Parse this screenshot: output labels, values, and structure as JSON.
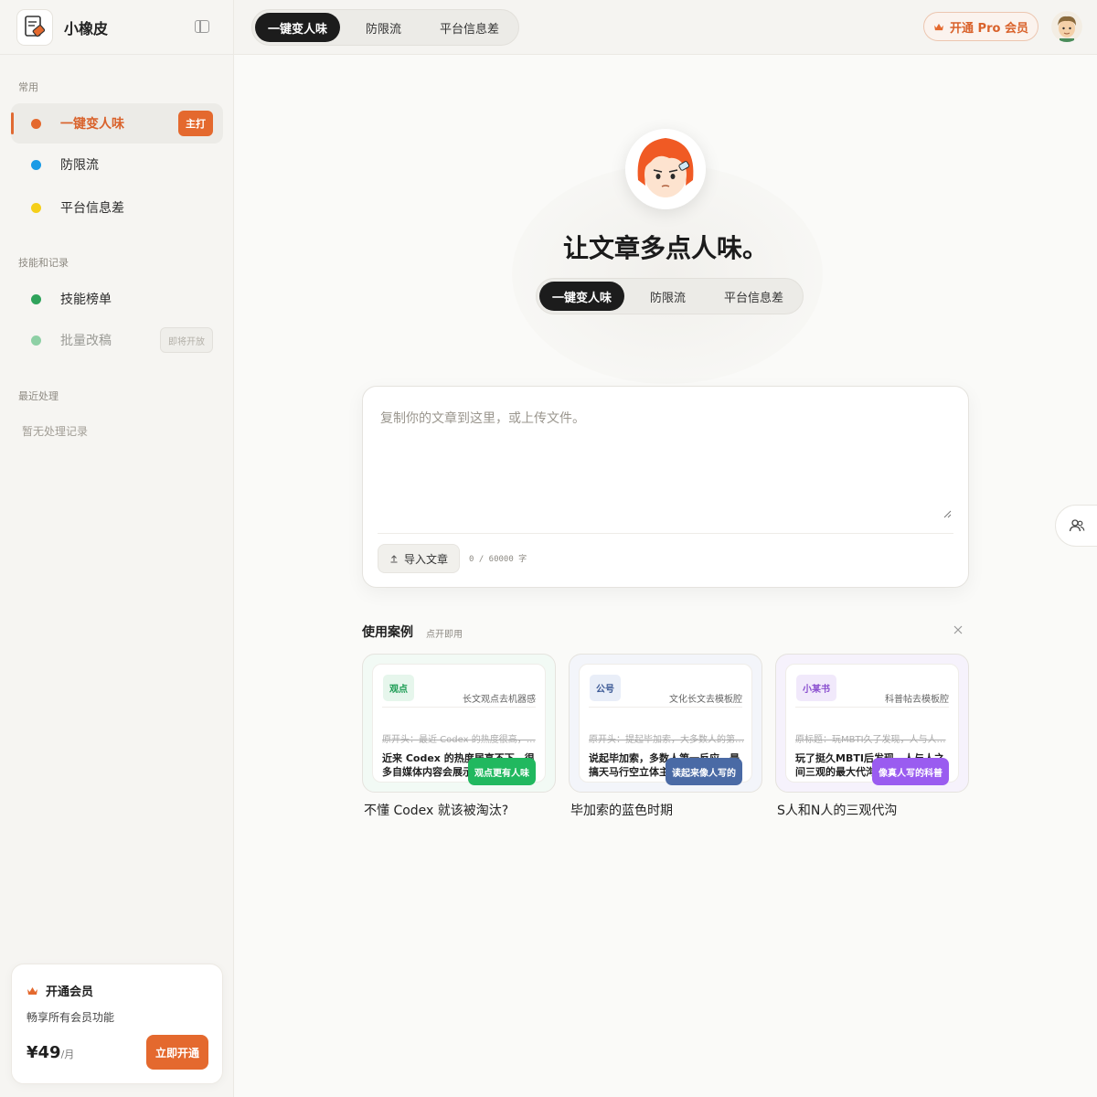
{
  "app": {
    "name": "小橡皮"
  },
  "sidebar": {
    "section_common": "常用",
    "section_skills": "技能和记录",
    "section_recent": "最近处理",
    "items": [
      {
        "label": "一键变人味",
        "dot": "#e4692e",
        "badge": "主打"
      },
      {
        "label": "防限流",
        "dot": "#1a9be6"
      },
      {
        "label": "平台信息差",
        "dot": "#f5cf1a"
      },
      {
        "label": "技能榜单",
        "dot": "#2fa35b"
      },
      {
        "label": "批量改稿",
        "dot": "#8ed0a5",
        "badge": "即将开放"
      }
    ],
    "recent_empty": "暂无处理记录",
    "membership": {
      "title": "开通会员",
      "subtitle": "畅享所有会员功能",
      "price": "¥49",
      "period": "/月",
      "button": "立即开通"
    }
  },
  "topbar": {
    "tabs": [
      "一键变人味",
      "防限流",
      "平台信息差"
    ],
    "active_tab": 0,
    "pro_button": "开通 Pro 会员"
  },
  "main": {
    "headline": "让文章多点人味。",
    "mode_tabs": [
      "一键变人味",
      "防限流",
      "平台信息差"
    ],
    "editor": {
      "placeholder": "复制你的文章到这里，或上传文件。",
      "import_button": "导入文章",
      "counter": "0 / 60000 字"
    },
    "cases": {
      "title": "使用案例",
      "subtitle": "点开即用",
      "items": [
        {
          "tag": "观点",
          "tag_color": "#1a9b52",
          "desc": "长文观点去机器感",
          "old": "原开头：最近 Codex 的热度很高，…",
          "new": "近来 Codex 的热度居高不下，很多自媒体内容会展示",
          "badge": "观点更有人味",
          "badge_color": "#21b85f",
          "caption": "不懂 Codex 就该被淘汰?"
        },
        {
          "tag": "公号",
          "tag_color": "#3d5a96",
          "desc": "文化长文去模板腔",
          "old": "原开头：提起毕加索，大多数人的第…",
          "new": "说起毕加索，多数人第一反应，是搞天马行空立体主",
          "badge": "读起来像人写的",
          "badge_color": "#4a6aa5",
          "caption": "毕加索的蓝色时期"
        },
        {
          "tag": "小某书",
          "tag_color": "#8a4fcf",
          "desc": "科普帖去模板腔",
          "old": "原标题：玩MBTI久了发现，人与人…",
          "new": "玩了挺久MBTI后发现，人与人之间三观的最大代沟",
          "badge": "像真人写的科普",
          "badge_color": "#9a5cf0",
          "caption": "S人和N人的三观代沟"
        }
      ]
    }
  }
}
